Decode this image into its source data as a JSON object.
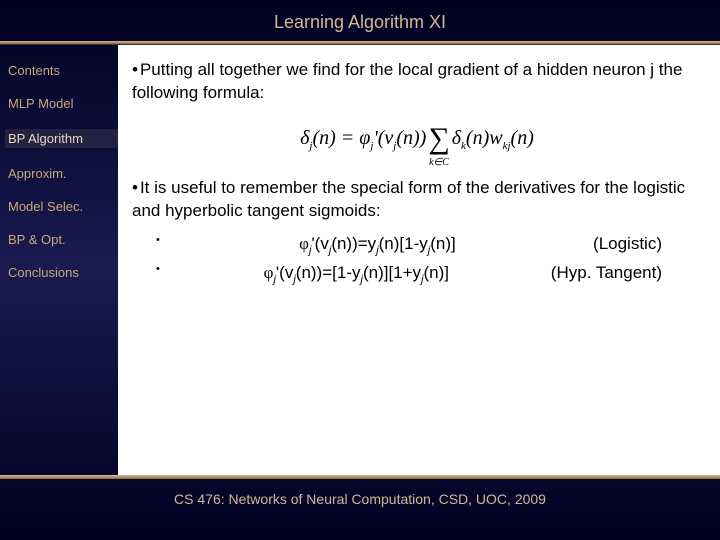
{
  "title": "Learning Algorithm XI",
  "sidebar": {
    "items": [
      {
        "label": "Contents"
      },
      {
        "label": "MLP Model"
      },
      {
        "label": "BP Algorithm"
      },
      {
        "label": "Approxim."
      },
      {
        "label": "Model Selec."
      },
      {
        "label": "BP & Opt."
      },
      {
        "label": "Conclusions"
      }
    ],
    "active_index": 2
  },
  "body": {
    "para1": "Putting all together we find for the local gradient of a hidden neuron j the following formula:",
    "formula_text": "δj(n) = φj'(vj(n)) Σ_{k∈C} δk(n) wkj(n)",
    "para2": "It is useful to remember the special form of the derivatives for the logistic and hyperbolic tangent sigmoids:",
    "deriv": {
      "logistic_formula": "φj'(vj(n))=yj(n)[1-yj(n)]",
      "logistic_label": "(Logistic)",
      "tanh_formula": "φj'(vj(n))=[1-yj(n)][1+yj(n)]",
      "tanh_label": "(Hyp. Tangent)"
    }
  },
  "footer": "CS 476: Networks of Neural Computation, CSD, UOC, 2009"
}
